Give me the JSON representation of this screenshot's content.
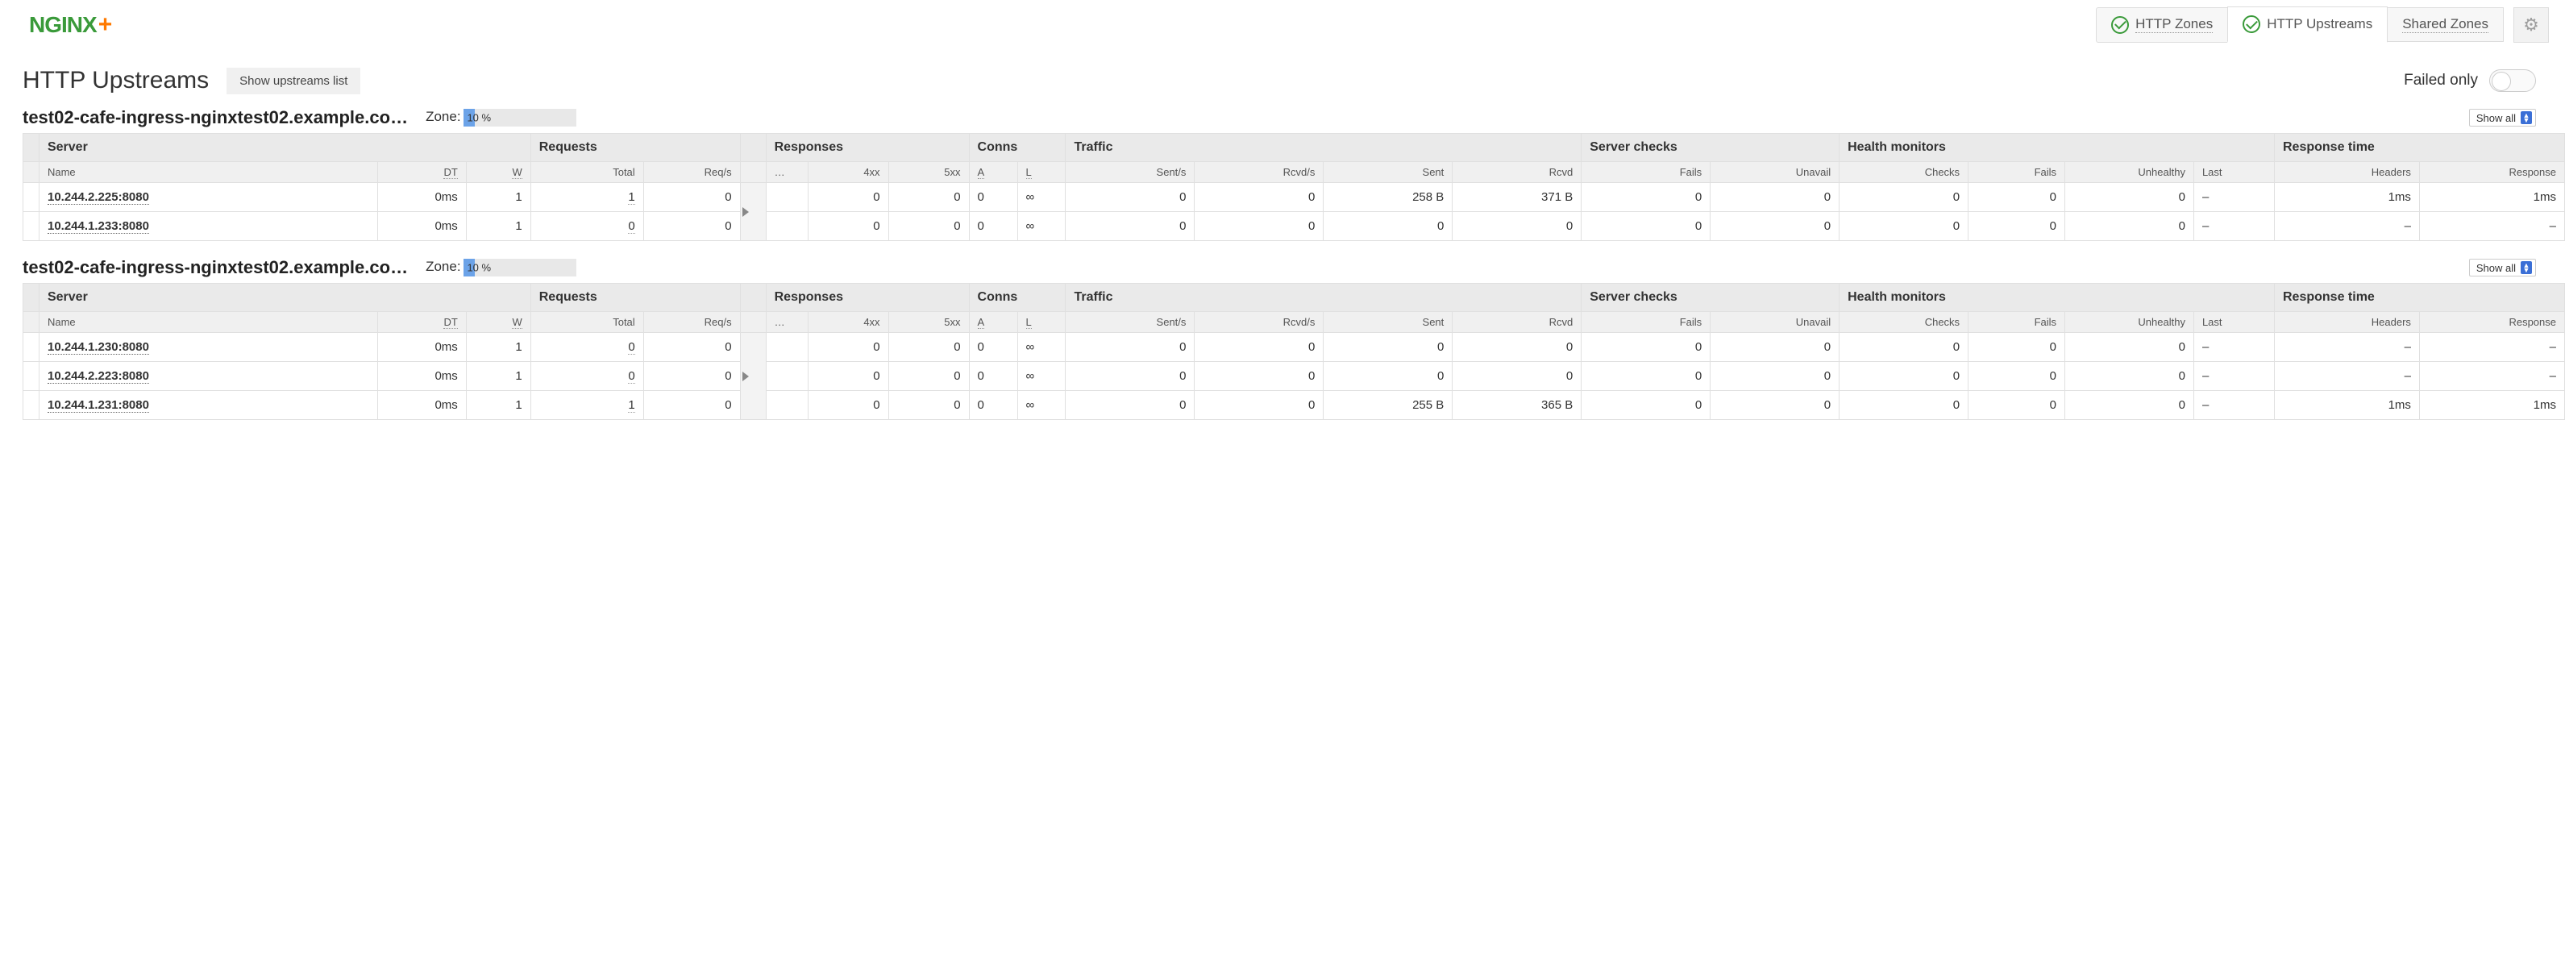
{
  "brand": {
    "name": "NGINX",
    "plus": "+"
  },
  "nav": {
    "items": [
      {
        "id": "http-zones",
        "label": "HTTP Zones",
        "status": "ok"
      },
      {
        "id": "http-upstreams",
        "label": "HTTP Upstreams",
        "status": "ok",
        "active": true
      },
      {
        "id": "shared-zones",
        "label": "Shared Zones"
      }
    ]
  },
  "page": {
    "title": "HTTP Upstreams",
    "show_list_btn": "Show upstreams list",
    "failed_only_label": "Failed only"
  },
  "controls": {
    "show_all_label": "Show all"
  },
  "columns": {
    "server": "Server",
    "requests": "Requests",
    "responses": "Responses",
    "conns": "Conns",
    "traffic": "Traffic",
    "server_checks": "Server checks",
    "health_monitors": "Health monitors",
    "response_time": "Response time",
    "name": "Name",
    "dt": "DT",
    "w": "W",
    "total": "Total",
    "reqs": "Req/s",
    "dots": "…",
    "xx4": "4xx",
    "xx5": "5xx",
    "a": "A",
    "l": "L",
    "sents": "Sent/s",
    "rcvds": "Rcvd/s",
    "sent": "Sent",
    "rcvd": "Rcvd",
    "fails": "Fails",
    "unavail": "Unavail",
    "checks": "Checks",
    "hfails": "Fails",
    "unhealthy": "Unhealthy",
    "last": "Last",
    "headers": "Headers",
    "response": "Response"
  },
  "zone_label": "Zone:",
  "upstreams": [
    {
      "name": "test02-cafe-ingress-nginxtest02.example.co…",
      "zone_text": "10 %",
      "zone_pct": 10,
      "servers": [
        {
          "name": "10.244.2.225:8080",
          "dt": "0ms",
          "w": "1",
          "total": "1",
          "reqs": "0",
          "r4xx": "0",
          "r5xx": "0",
          "a": "0",
          "l": "∞",
          "sents": "0",
          "rcvds": "0",
          "sent": "258 B",
          "rcvd": "371 B",
          "fails": "0",
          "unavail": "0",
          "checks": "0",
          "hfails": "0",
          "unhealthy": "0",
          "last": "–",
          "headers": "1ms",
          "response": "1ms"
        },
        {
          "name": "10.244.1.233:8080",
          "dt": "0ms",
          "w": "1",
          "total": "0",
          "reqs": "0",
          "r4xx": "0",
          "r5xx": "0",
          "a": "0",
          "l": "∞",
          "sents": "0",
          "rcvds": "0",
          "sent": "0",
          "rcvd": "0",
          "fails": "0",
          "unavail": "0",
          "checks": "0",
          "hfails": "0",
          "unhealthy": "0",
          "last": "–",
          "headers": "–",
          "response": "–"
        }
      ]
    },
    {
      "name": "test02-cafe-ingress-nginxtest02.example.co…",
      "zone_text": "10 %",
      "zone_pct": 10,
      "servers": [
        {
          "name": "10.244.1.230:8080",
          "dt": "0ms",
          "w": "1",
          "total": "0",
          "reqs": "0",
          "r4xx": "0",
          "r5xx": "0",
          "a": "0",
          "l": "∞",
          "sents": "0",
          "rcvds": "0",
          "sent": "0",
          "rcvd": "0",
          "fails": "0",
          "unavail": "0",
          "checks": "0",
          "hfails": "0",
          "unhealthy": "0",
          "last": "–",
          "headers": "–",
          "response": "–"
        },
        {
          "name": "10.244.2.223:8080",
          "dt": "0ms",
          "w": "1",
          "total": "0",
          "reqs": "0",
          "r4xx": "0",
          "r5xx": "0",
          "a": "0",
          "l": "∞",
          "sents": "0",
          "rcvds": "0",
          "sent": "0",
          "rcvd": "0",
          "fails": "0",
          "unavail": "0",
          "checks": "0",
          "hfails": "0",
          "unhealthy": "0",
          "last": "–",
          "headers": "–",
          "response": "–"
        },
        {
          "name": "10.244.1.231:8080",
          "dt": "0ms",
          "w": "1",
          "total": "1",
          "reqs": "0",
          "r4xx": "0",
          "r5xx": "0",
          "a": "0",
          "l": "∞",
          "sents": "0",
          "rcvds": "0",
          "sent": "255 B",
          "rcvd": "365 B",
          "fails": "0",
          "unavail": "0",
          "checks": "0",
          "hfails": "0",
          "unhealthy": "0",
          "last": "–",
          "headers": "1ms",
          "response": "1ms"
        }
      ]
    }
  ]
}
